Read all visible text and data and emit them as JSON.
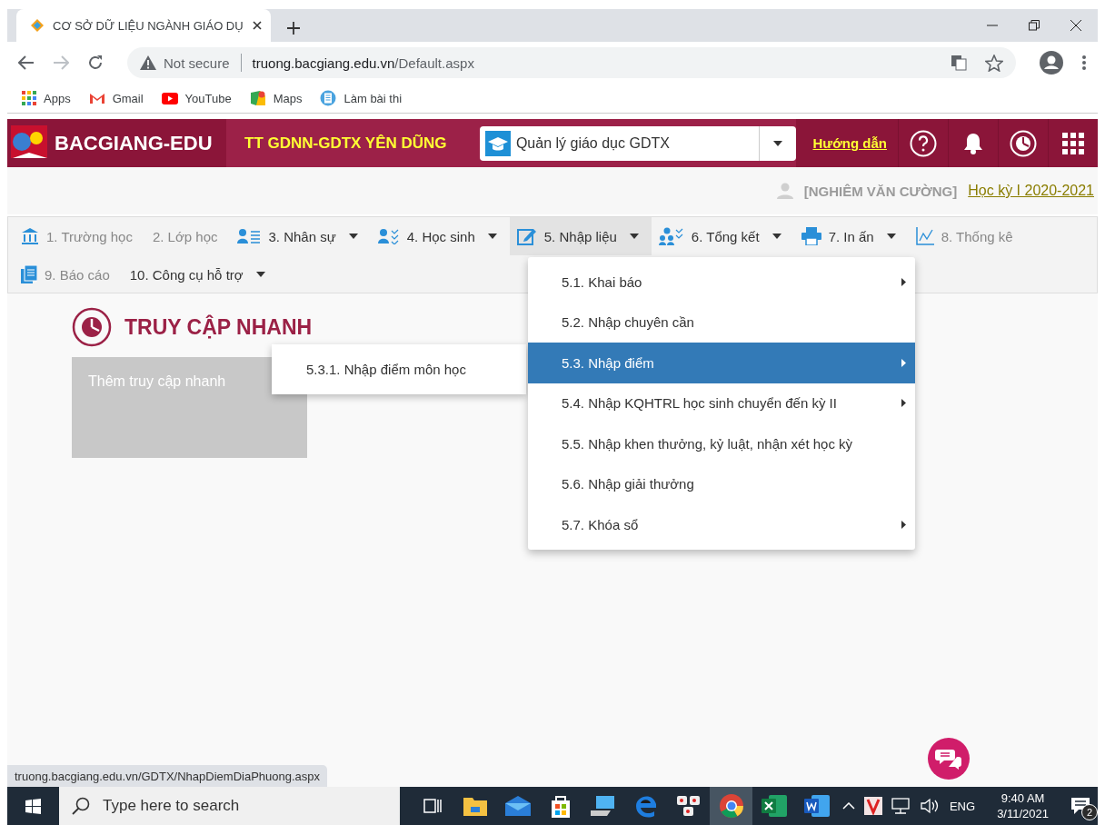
{
  "browser": {
    "tab_title": "CƠ SỞ DỮ LIỆU NGÀNH GIÁO DỤ",
    "address": {
      "security": "Not secure",
      "host": "truong.bacgiang.edu.vn",
      "path": "/Default.aspx"
    },
    "bookmarks": [
      "Apps",
      "Gmail",
      "YouTube",
      "Maps",
      "Làm bài thi"
    ]
  },
  "header": {
    "brand": "BACGIANG-EDU",
    "school": "TT GDNN-GDTX YÊN DŨNG",
    "module_select": "Quản lý giáo dục GDTX",
    "guide_link": "Hướng dẫn"
  },
  "user_bar": {
    "user": "[NGHIÊM VĂN CƯỜNG]",
    "semester": "Học kỳ I 2020-2021"
  },
  "menu": {
    "rows": [
      [
        {
          "label": "1. Trường học",
          "dropdown": false,
          "dimmed": true,
          "selected": false
        },
        {
          "label": "2. Lớp học",
          "dropdown": false,
          "dimmed": true,
          "selected": false
        },
        {
          "label": "3. Nhân sự",
          "dropdown": true,
          "dimmed": false,
          "selected": false
        },
        {
          "label": "4. Học sinh",
          "dropdown": true,
          "dimmed": false,
          "selected": false
        },
        {
          "label": "5. Nhập liệu",
          "dropdown": true,
          "dimmed": false,
          "selected": true
        },
        {
          "label": "6. Tổng kết",
          "dropdown": true,
          "dimmed": false,
          "selected": false
        },
        {
          "label": "7. In ấn",
          "dropdown": true,
          "dimmed": false,
          "selected": false
        },
        {
          "label": "8. Thống kê",
          "dropdown": false,
          "dimmed": true,
          "selected": false
        }
      ],
      [
        {
          "label": "9. Báo cáo",
          "dropdown": false,
          "dimmed": true,
          "selected": false
        },
        {
          "label": "10. Công cụ hỗ trợ",
          "dropdown": true,
          "dimmed": false,
          "selected": false
        }
      ]
    ]
  },
  "dropdown": [
    {
      "label": "5.1. Khai báo",
      "submenu": true,
      "selected": false
    },
    {
      "label": "5.2. Nhập chuyên cần",
      "submenu": false,
      "selected": false
    },
    {
      "label": "5.3. Nhập điểm",
      "submenu": true,
      "selected": true
    },
    {
      "label": "5.4. Nhập KQHTRL học sinh chuyển đến kỳ II",
      "submenu": true,
      "selected": false
    },
    {
      "label": "5.5. Nhập khen thưởng, kỷ luật, nhận xét học kỳ",
      "submenu": false,
      "selected": false
    },
    {
      "label": "5.6. Nhập giải thưởng",
      "submenu": false,
      "selected": false
    },
    {
      "label": "5.7. Khóa sổ",
      "submenu": true,
      "selected": false
    }
  ],
  "submenu": [
    "5.3.1. Nhập điểm môn học"
  ],
  "quick_access": {
    "title": "TRUY CẬP NHANH",
    "card": "Thêm truy cập nhanh"
  },
  "status_url": "truong.bacgiang.edu.vn/GDTX/NhapDiemDiaPhuong.aspx",
  "taskbar": {
    "search_placeholder": "Type here to search",
    "apps": [
      {
        "selected": false
      },
      {
        "selected": false
      },
      {
        "selected": false
      },
      {
        "selected": false
      },
      {
        "selected": false
      },
      {
        "selected": false
      },
      {
        "selected": false
      },
      {
        "selected": true
      },
      {
        "selected": false
      },
      {
        "selected": false
      }
    ],
    "language": "ENG",
    "time": "9:40 AM",
    "date": "3/11/2021",
    "notifications": "2"
  }
}
